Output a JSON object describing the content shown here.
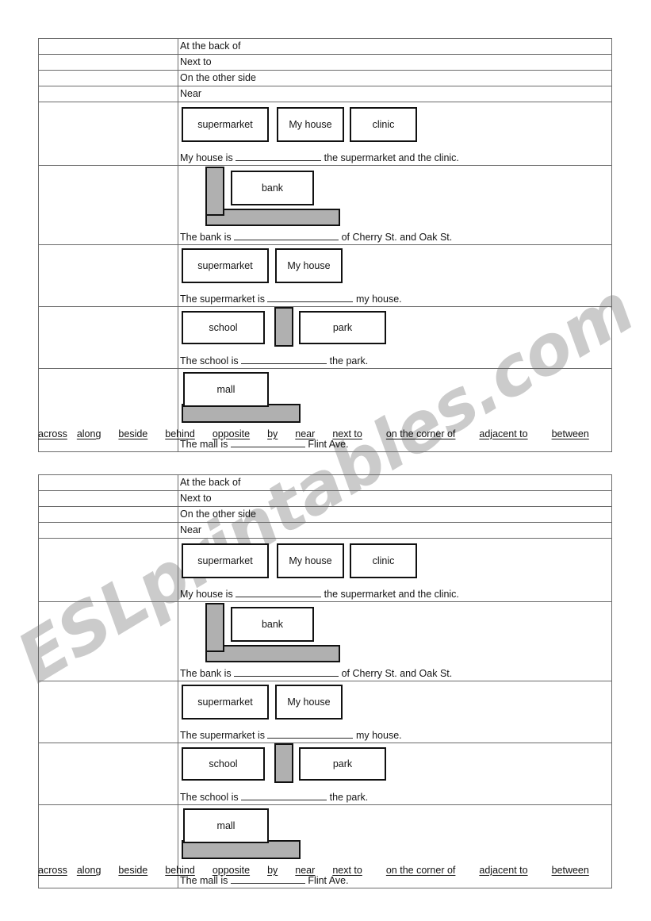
{
  "watermark": {
    "text": "ESLprintables.com",
    "color": "#c9c9c9"
  },
  "worksheet": {
    "prepositions": [
      "At the back of",
      "Next to",
      "On the other side",
      "Near"
    ],
    "exercises": [
      {
        "id": "my-house",
        "places": [
          "supermarket",
          "My house",
          "clinic"
        ],
        "sentence_before": "My house is",
        "sentence_after": "the supermarket and the clinic."
      },
      {
        "id": "bank",
        "places": [
          "bank"
        ],
        "sentence_before": "The bank is",
        "sentence_after": "of Cherry St. and Oak St."
      },
      {
        "id": "supermarket",
        "places": [
          "supermarket",
          "My house"
        ],
        "sentence_before": "The supermarket is",
        "sentence_after": "my house."
      },
      {
        "id": "school",
        "places": [
          "school",
          "park"
        ],
        "sentence_before": "The school is",
        "sentence_after": "the park."
      },
      {
        "id": "mall",
        "places": [
          "mall"
        ],
        "sentence_before": "The mall is",
        "sentence_after": "Flint Ave."
      }
    ],
    "word_bank": [
      "across",
      "along",
      "beside",
      "behind",
      "opposite",
      "by",
      "near",
      "next to",
      "on the corner of",
      "adjacent to",
      "between"
    ]
  },
  "colors": {
    "street_fill": "#b0b0b0",
    "box_border": "#111111",
    "table_border": "#6b6b6b"
  }
}
